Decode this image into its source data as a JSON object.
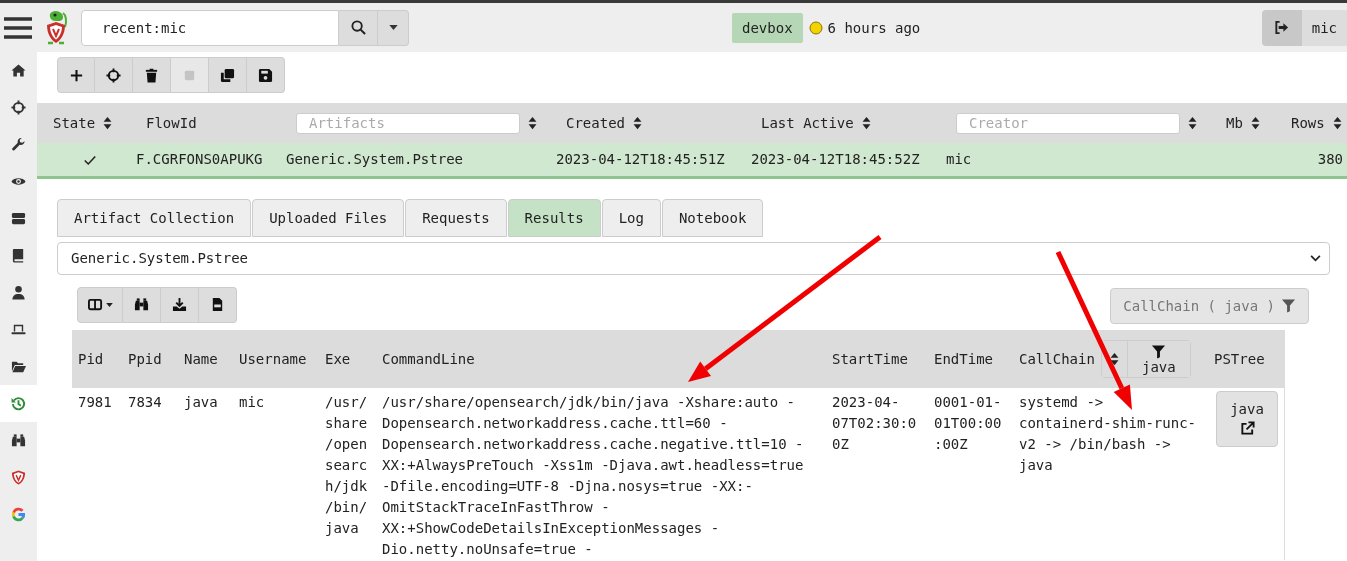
{
  "top_bar": {
    "search": {
      "value": "recent:mic"
    },
    "org": "devbox",
    "last_seen": "6 hours ago",
    "user": "mic"
  },
  "sidebar": {
    "items": [
      {
        "kind": "home",
        "selected": false
      },
      {
        "kind": "target",
        "selected": false
      },
      {
        "kind": "wrench",
        "selected": false
      },
      {
        "kind": "eye",
        "selected": false
      },
      {
        "kind": "server",
        "selected": false
      },
      {
        "kind": "book",
        "selected": false
      },
      {
        "kind": "user",
        "selected": false
      },
      {
        "kind": "laptop",
        "selected": false
      },
      {
        "kind": "folder",
        "selected": false
      },
      {
        "kind": "history",
        "selected": true
      },
      {
        "kind": "binoculars",
        "selected": false
      },
      {
        "kind": "shield",
        "selected": false
      },
      {
        "kind": "google",
        "selected": false
      }
    ]
  },
  "flow_toolbar": {
    "buttons": [
      {
        "kind": "add",
        "disabled": false
      },
      {
        "kind": "target",
        "disabled": false
      },
      {
        "kind": "delete",
        "disabled": false
      },
      {
        "kind": "stop",
        "disabled": true
      },
      {
        "kind": "copy",
        "disabled": false
      },
      {
        "kind": "save",
        "disabled": false
      }
    ]
  },
  "flows_table": {
    "columns": [
      {
        "label": "State",
        "sortable": true
      },
      {
        "label": "FlowId",
        "sortable": false
      },
      {
        "placeholder": "Artifacts",
        "sortable": true
      },
      {
        "label": "Created",
        "sortable": true
      },
      {
        "label": "Last Active",
        "sortable": true
      },
      {
        "placeholder": "Creator",
        "sortable": true
      },
      {
        "label": "Mb",
        "sortable": true
      },
      {
        "label": "Rows",
        "sortable": true
      }
    ],
    "rows": [
      {
        "selected": true,
        "finished": true,
        "flow_id": "F.CGRFONS0APUKG",
        "artifacts": "Generic.System.Pstree",
        "created": "2023-04-12T18:45:51Z",
        "last_active": "2023-04-12T18:45:52Z",
        "creator": "mic",
        "rows": "380"
      }
    ]
  },
  "tabs": [
    {
      "label": "Artifact Collection",
      "selected": false
    },
    {
      "label": "Uploaded Files",
      "selected": false
    },
    {
      "label": "Requests",
      "selected": false
    },
    {
      "label": "Results",
      "selected": true
    },
    {
      "label": "Log",
      "selected": false
    },
    {
      "label": "Notebook",
      "selected": false
    }
  ],
  "artifact_select": {
    "value": "Generic.System.Pstree"
  },
  "results_toolbar": {
    "buttons": [
      {
        "kind": "columns"
      },
      {
        "kind": "search"
      },
      {
        "kind": "download"
      },
      {
        "kind": "csv"
      }
    ]
  },
  "active_filter": {
    "label": "CallChain ( java )"
  },
  "results_table": {
    "columns": [
      {
        "label": "Pid"
      },
      {
        "label": "Ppid"
      },
      {
        "label": "Name"
      },
      {
        "label": "Username"
      },
      {
        "label": "Exe"
      },
      {
        "label": "CommandLine"
      },
      {
        "label": "StartTime"
      },
      {
        "label": "EndTime"
      },
      {
        "label": "CallChain",
        "sortable": true,
        "filter": "java"
      },
      {
        "label": "PSTree"
      }
    ],
    "rows": [
      {
        "cells": [
          "7981",
          "7834",
          "java",
          "mic",
          "/usr/share/opensearch/jdk/bin/java",
          "/usr/share/opensearch/jdk/bin/java -Xshare:auto -Dopensearch.networkaddress.cache.ttl=60 -Dopensearch.networkaddress.cache.negative.ttl=10 -XX:+AlwaysPreTouch -Xss1m -Djava.awt.headless=true -Dfile.encoding=UTF-8 -Djna.nosys=true -XX:-OmitStackTraceInFastThrow -XX:+ShowCodeDetailsInExceptionMessages -Dio.netty.noUnsafe=true -",
          "2023-04-07T02:30:00Z",
          "0001-01-01T00:00:00Z",
          "systemd -> containerd-shim-runc-v2 -> /bin/bash -> java"
        ],
        "pstree": "java"
      }
    ]
  }
}
